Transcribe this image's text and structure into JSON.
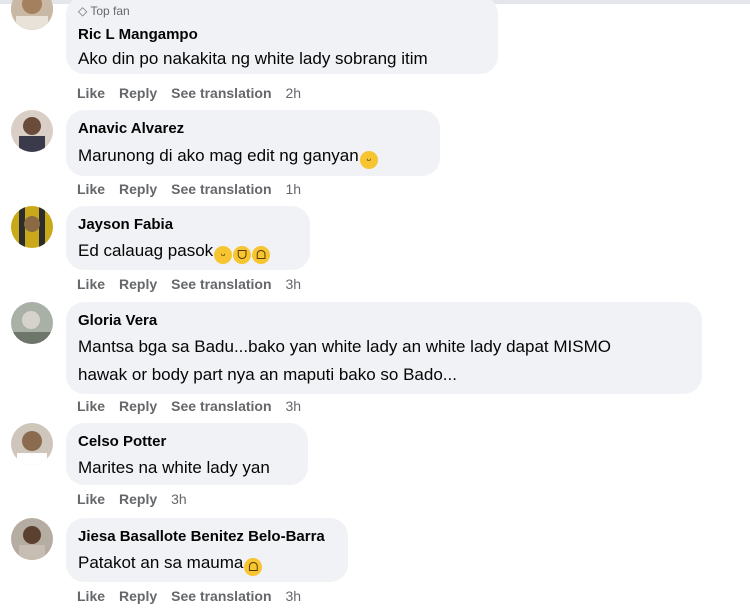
{
  "comments": [
    {
      "name": "Ric L Mangampo",
      "badge": "Top fan",
      "text": "Ako din po nakakita ng white lady sobrang itim",
      "actions": [
        "Like",
        "Reply",
        "See translation"
      ],
      "time": "2h"
    },
    {
      "name": "Anavic Alvarez",
      "text": "Marunong di ako mag edit ng ganyan",
      "emojis": [
        "grin-emoji"
      ],
      "actions": [
        "Like",
        "Reply",
        "See translation"
      ],
      "time": "1h"
    },
    {
      "name": "Jayson Fabia",
      "text": "Ed calauag pasok",
      "emojis": [
        "grin-emoji",
        "laugh-emoji",
        "rofl-emoji"
      ],
      "actions": [
        "Like",
        "Reply",
        "See translation"
      ],
      "time": "3h"
    },
    {
      "name": "Gloria Vera",
      "text_line1": "Mantsa bga sa Badu...bako yan white lady an white lady dapat MISMO",
      "text_line2": "hawak or body part nya an maputi bako so Bado...",
      "actions": [
        "Like",
        "Reply",
        "See translation"
      ],
      "time": "3h"
    },
    {
      "name": "Celso Potter",
      "text": "Marites na white lady yan",
      "actions": [
        "Like",
        "Reply"
      ],
      "time": "3h"
    },
    {
      "name": "Jiesa Basallote Benitez Belo-Barra",
      "text": "Patakot an sa mauma",
      "emojis": [
        "rofl-emoji"
      ],
      "actions": [
        "Like",
        "Reply",
        "See translation"
      ],
      "time": "3h"
    }
  ]
}
